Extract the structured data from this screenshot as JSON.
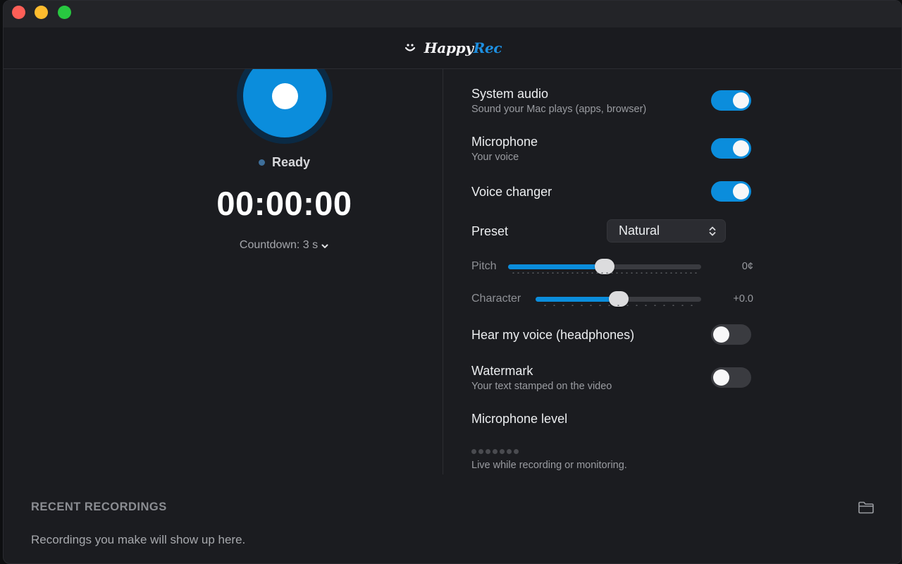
{
  "app": {
    "logo_word1": "Happy",
    "logo_word2": "Rec",
    "logo_icon": "smile-icon",
    "accent_color": "#0b8ddc"
  },
  "recorder": {
    "status": "Ready",
    "timer": "00:00:00",
    "countdown_label": "Countdown: 3 s"
  },
  "settings": {
    "system_audio": {
      "title": "System audio",
      "subtitle": "Sound your Mac plays (apps, browser)",
      "enabled": true
    },
    "microphone": {
      "title": "Microphone",
      "subtitle": "Your voice",
      "enabled": true
    },
    "voice_changer": {
      "title": "Voice changer",
      "enabled": true
    },
    "preset": {
      "label": "Preset",
      "value": "Natural"
    },
    "pitch": {
      "label": "Pitch",
      "value": "0¢",
      "fraction": 0.5
    },
    "character": {
      "label": "Character",
      "value": "+0.0",
      "fraction": 0.5
    },
    "hear_voice": {
      "title": "Hear my voice (headphones)",
      "enabled": false
    },
    "watermark": {
      "title": "Watermark",
      "subtitle": "Your text stamped on the video",
      "enabled": false
    },
    "mic_level": {
      "title": "Microphone level",
      "note": "Live while recording or monitoring.",
      "level": 0
    }
  },
  "recent": {
    "title": "RECENT RECORDINGS",
    "empty_text": "Recordings you make will show up here.",
    "folder_icon": "folder-icon"
  }
}
